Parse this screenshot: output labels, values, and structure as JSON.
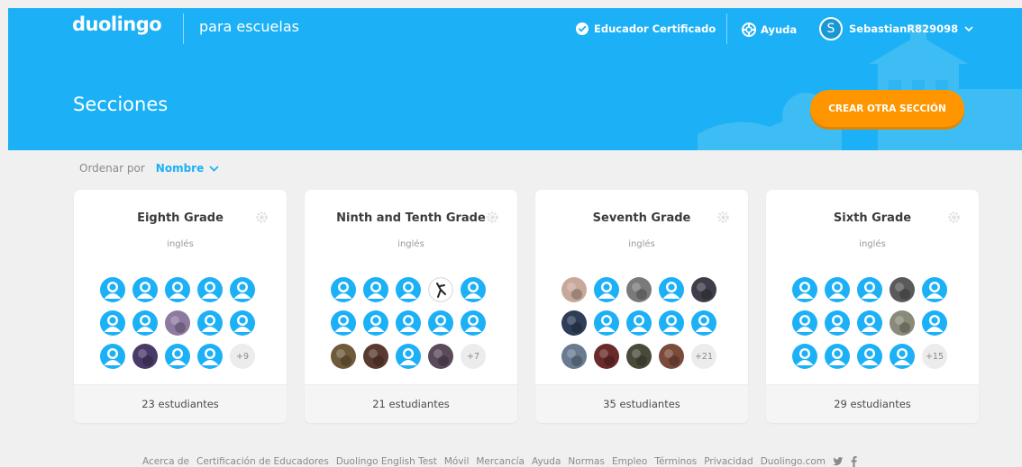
{
  "header": {
    "logo": "duolingo",
    "subbrand": "para escuelas",
    "certified_label": "Educador Certificado",
    "help_label": "Ayuda",
    "user_initial": "S",
    "username": "SebastianR829098",
    "page_title": "Secciones",
    "create_button": "CREAR OTRA SECCIÓN"
  },
  "sort": {
    "label": "Ordenar por",
    "value": "Nombre"
  },
  "sections": [
    {
      "name": "Eighth Grade",
      "language": "inglés",
      "students": "23 estudiantes",
      "more": "+9",
      "avatars": [
        "d",
        "d",
        "d",
        "d",
        "d",
        "d",
        "d",
        "p:#8e7aa0",
        "d",
        "d",
        "d",
        "p:#4a3a6a",
        "d",
        "d"
      ]
    },
    {
      "name": "Ninth and Tenth Grade",
      "language": "inglés",
      "students": "21 estudiantes",
      "more": "+7",
      "avatars": [
        "d",
        "d",
        "d",
        "w",
        "d",
        "d",
        "d",
        "d",
        "d",
        "d",
        "p:#6f5a3a",
        "p:#5a3a30",
        "d",
        "p:#5a4a5a"
      ]
    },
    {
      "name": "Seventh Grade",
      "language": "inglés",
      "students": "35 estudiantes",
      "more": "+21",
      "avatars": [
        "p:#c8a89a",
        "d",
        "p:#7a7a7a",
        "d",
        "p:#3e3e4a",
        "p:#2e3e58",
        "d",
        "d",
        "d",
        "d",
        "p:#6a7a90",
        "p:#6a2a2a",
        "p:#4a4a3a",
        "p:#7a4a3a"
      ]
    },
    {
      "name": "Sixth Grade",
      "language": "inglés",
      "students": "29 estudiantes",
      "more": "+15",
      "avatars": [
        "d",
        "d",
        "d",
        "p:#5a5a5a",
        "d",
        "d",
        "d",
        "d",
        "p:#8a8a7a",
        "d",
        "d",
        "d",
        "d",
        "d"
      ]
    }
  ],
  "footer": [
    "Acerca de",
    "Certificación de Educadores",
    "Duolingo English Test",
    "Móvil",
    "Mercancía",
    "Ayuda",
    "Normas",
    "Empleo",
    "Términos",
    "Privacidad",
    "Duolingo.com"
  ],
  "colors": {
    "brand": "#1cb0f6",
    "accent": "#ff9600",
    "avatar_default": "#1cb0f6"
  }
}
